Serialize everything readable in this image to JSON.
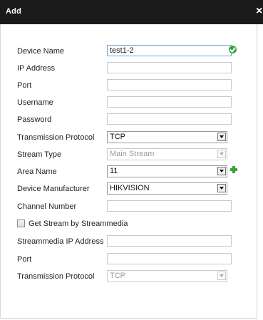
{
  "dialog": {
    "title": "Add",
    "close_glyph": "×"
  },
  "form": {
    "device_name": {
      "label": "Device Name",
      "value": "test1-2"
    },
    "ip_address": {
      "label": "IP Address",
      "value": ""
    },
    "port": {
      "label": "Port",
      "value": ""
    },
    "username": {
      "label": "Username",
      "value": ""
    },
    "password": {
      "label": "Password",
      "value": ""
    },
    "transmission_protocol": {
      "label": "Transmission Protocol",
      "value": "TCP"
    },
    "stream_type": {
      "label": "Stream Type",
      "value": "Main Stream"
    },
    "area_name": {
      "label": "Area Name",
      "value": "11"
    },
    "device_manufacturer": {
      "label": "Device Manufacturer",
      "value": "HIKVISION"
    },
    "channel_number": {
      "label": "Channel Number",
      "value": ""
    },
    "get_stream": {
      "label": "Get Stream by Streammedia",
      "checked": false
    },
    "streammedia_ip": {
      "label": "Streammedia IP Address",
      "value": ""
    },
    "streammedia_port": {
      "label": "Port",
      "value": ""
    },
    "streammedia_protocol": {
      "label": "Transmission Protocol",
      "value": "TCP"
    }
  },
  "icons": {
    "valid": "check-circle-icon",
    "add": "plus-icon",
    "dropdown": "chevron-down-icon",
    "close": "close-icon"
  },
  "colors": {
    "titlebar": "#1b1b1b",
    "valid_green": "#3aa33a",
    "focus_border": "#6fa8dc",
    "disabled_text": "#9a9a9a"
  }
}
